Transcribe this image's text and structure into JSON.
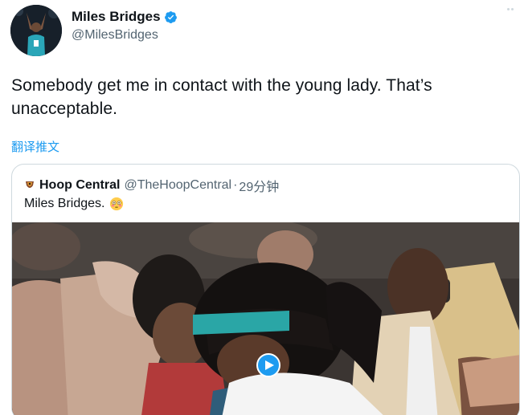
{
  "author": {
    "display_name": "Miles Bridges",
    "handle": "@MilesBridges",
    "verified": true,
    "verified_icon": "verified-badge-icon",
    "more_icon": "more-dots-icon"
  },
  "tweet": {
    "text": "Somebody get me in contact with the young lady. That’s unacceptable.",
    "translate_label": "翻译推文"
  },
  "quoted_tweet": {
    "author_name": "Hoop Central",
    "author_handle": "@TheHoopCentral",
    "separator": "·",
    "time": "29分钟",
    "text": "Miles Bridges.",
    "emoji": "flushed-face-emoji",
    "media": {
      "type": "video",
      "play_icon": "play-icon"
    }
  },
  "colors": {
    "accent": "#1d9bf0",
    "text_primary": "#0f1419",
    "text_secondary": "#536471",
    "border": "#cfd9de",
    "headband": "#2aa6a6"
  }
}
